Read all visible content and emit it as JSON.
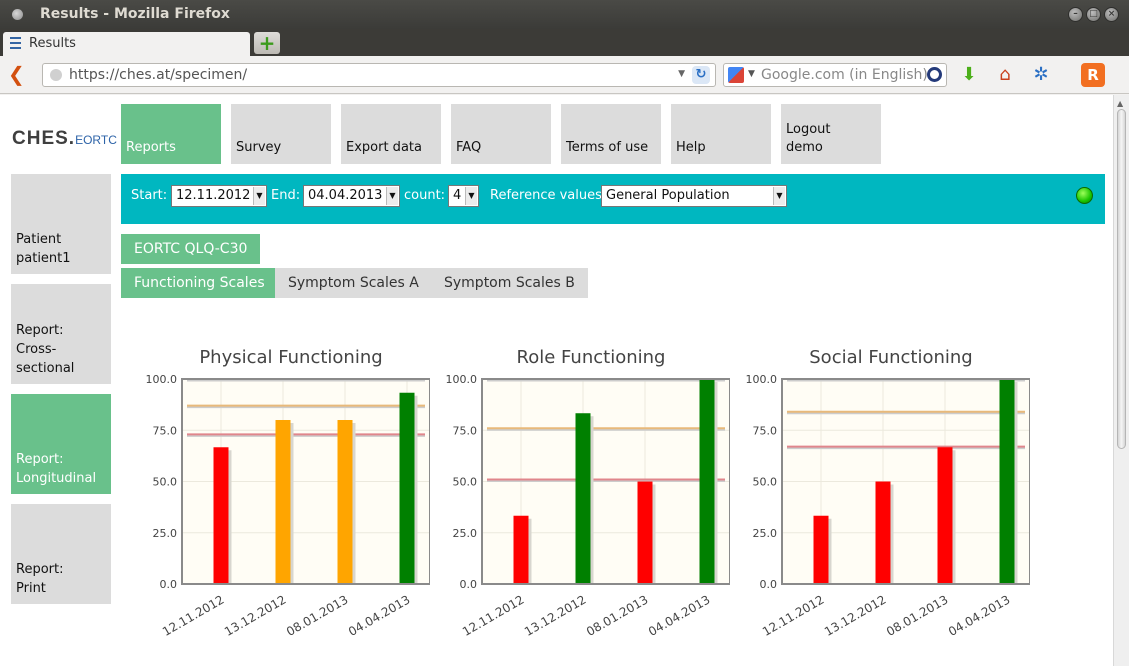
{
  "window": {
    "title": "Results - Mozilla Firefox"
  },
  "browser": {
    "tab_label": "Results",
    "url": "https://ches.at/specimen/",
    "search_placeholder": "Google.com (in English)"
  },
  "logo": {
    "main": "CHES.",
    "sub": "EORTC"
  },
  "topnav": {
    "items": [
      {
        "label": "Reports",
        "active": true
      },
      {
        "label": "Survey"
      },
      {
        "label": "Export data"
      },
      {
        "label": "FAQ"
      },
      {
        "label": "Terms of use"
      },
      {
        "label": "Help"
      },
      {
        "label": "Logout",
        "label2": "demo"
      }
    ]
  },
  "sidenav": {
    "items": [
      {
        "lines": [
          "Patient",
          "patient1"
        ]
      },
      {
        "lines": [
          "Report:",
          "Cross-",
          "sectional"
        ]
      },
      {
        "lines": [
          "Report:",
          "Longitudinal"
        ],
        "active": true
      },
      {
        "lines": [
          "Report:",
          "Print"
        ]
      }
    ]
  },
  "filters": {
    "start_label": "Start:",
    "start_value": "12.11.2012",
    "end_label": "End:",
    "end_value": "04.04.2013",
    "count_label": "count:",
    "count_value": "4",
    "ref_label": "Reference values:",
    "ref_value": "General Population",
    "status_color": "#19c400"
  },
  "questionnaire_tab": "EORTC QLQ-C30",
  "scale_tabs": [
    {
      "label": "Functioning Scales",
      "active": true
    },
    {
      "label": "Symptom Scales A"
    },
    {
      "label": "Symptom Scales B"
    }
  ],
  "chart_data": [
    {
      "type": "bar",
      "title": "Physical Functioning",
      "categories": [
        "12.11.2012",
        "13.12.2012",
        "08.01.2013",
        "04.04.2013"
      ],
      "values": [
        66.7,
        80,
        80,
        93.3
      ],
      "colors": [
        "#ff0000",
        "#ffa500",
        "#ffa500",
        "#008000"
      ],
      "reference_lines": [
        {
          "value": 100,
          "color": "#8fc98f"
        },
        {
          "value": 87,
          "color": "#e8b97a"
        },
        {
          "value": 73,
          "color": "#e0868c"
        }
      ],
      "yticks": [
        "0.0",
        "25.0",
        "50.0",
        "75.0",
        "100.0"
      ],
      "ylim": [
        0,
        100
      ],
      "grid": true
    },
    {
      "type": "bar",
      "title": "Role Functioning",
      "categories": [
        "12.11.2012",
        "13.12.2012",
        "08.01.2013",
        "04.04.2013"
      ],
      "values": [
        33.3,
        83.3,
        50,
        100
      ],
      "colors": [
        "#ff0000",
        "#008000",
        "#ff0000",
        "#008000"
      ],
      "reference_lines": [
        {
          "value": 100,
          "color": "#8fc98f"
        },
        {
          "value": 76,
          "color": "#e8b97a"
        },
        {
          "value": 51,
          "color": "#e0868c"
        }
      ],
      "yticks": [
        "0.0",
        "25.0",
        "50.0",
        "75.0",
        "100.0"
      ],
      "ylim": [
        0,
        100
      ],
      "grid": true
    },
    {
      "type": "bar",
      "title": "Social Functioning",
      "categories": [
        "12.11.2012",
        "13.12.2012",
        "08.01.2013",
        "04.04.2013"
      ],
      "values": [
        33.3,
        50,
        66.7,
        100
      ],
      "colors": [
        "#ff0000",
        "#ff0000",
        "#ff0000",
        "#008000"
      ],
      "reference_lines": [
        {
          "value": 100,
          "color": "#8fc98f"
        },
        {
          "value": 84,
          "color": "#e8b97a"
        },
        {
          "value": 67,
          "color": "#e0868c"
        }
      ],
      "yticks": [
        "0.0",
        "25.0",
        "50.0",
        "75.0",
        "100.0"
      ],
      "ylim": [
        0,
        100
      ],
      "grid": true
    }
  ]
}
